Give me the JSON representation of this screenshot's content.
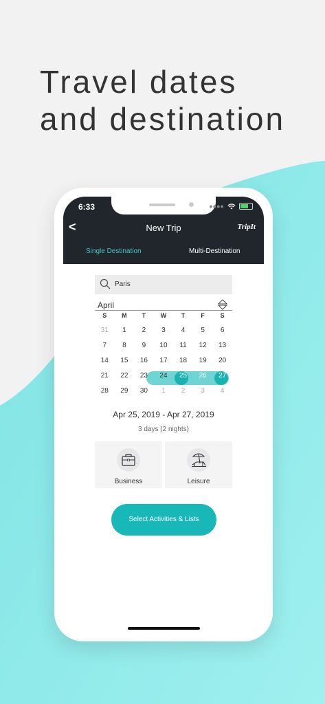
{
  "headline": {
    "line1": "Travel dates",
    "line2": "and destination"
  },
  "status": {
    "time": "6:33"
  },
  "nav": {
    "back": "<",
    "title": "New Trip",
    "logo": "TripIt"
  },
  "tabs": {
    "single": "Single Destination",
    "multi": "Multi-Destination"
  },
  "search": {
    "value": "Paris"
  },
  "calendar": {
    "month": "April",
    "weekdays": [
      "S",
      "M",
      "T",
      "W",
      "T",
      "F",
      "S"
    ],
    "weeks": [
      [
        "31",
        "1",
        "2",
        "3",
        "4",
        "5",
        "6"
      ],
      [
        "7",
        "8",
        "9",
        "10",
        "11",
        "12",
        "13"
      ],
      [
        "14",
        "15",
        "16",
        "17",
        "18",
        "19",
        "20"
      ],
      [
        "21",
        "22",
        "23",
        "24",
        "25",
        "26",
        "27"
      ],
      [
        "28",
        "29",
        "30",
        "1",
        "2",
        "3",
        "4"
      ]
    ]
  },
  "summary": {
    "range": "Apr 25, 2019 - Apr 27, 2019",
    "duration": "3 days (2 nights)"
  },
  "trip_types": {
    "business": "Business",
    "leisure": "Leisure"
  },
  "cta": {
    "label": "Select Activities & Lists"
  },
  "colors": {
    "accent": "#19b8b8",
    "range_light": "#6fd4d4",
    "dark_bar": "#21262d",
    "wave": "#8fe8e8"
  }
}
